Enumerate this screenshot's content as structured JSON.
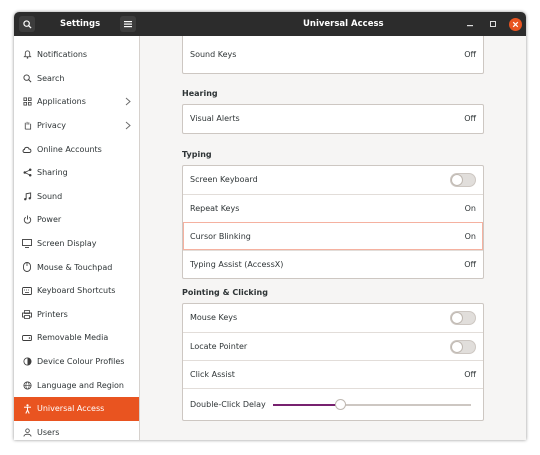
{
  "titlebar": {
    "left_title": "Settings",
    "title": "Universal Access",
    "search_icon": "search-icon",
    "menu_icon": "hamburger-menu-icon"
  },
  "sidebar": {
    "items": [
      {
        "label": "Notifications",
        "icon": "bell-icon"
      },
      {
        "label": "Search",
        "icon": "search-icon"
      },
      {
        "label": "Applications",
        "icon": "applications-grid-icon",
        "chevron": true
      },
      {
        "label": "Privacy",
        "icon": "hand-privacy-icon",
        "chevron": true
      },
      {
        "label": "Online Accounts",
        "icon": "cloud-icon"
      },
      {
        "label": "Sharing",
        "icon": "share-icon"
      },
      {
        "label": "Sound",
        "icon": "music-note-icon"
      },
      {
        "label": "Power",
        "icon": "power-icon"
      },
      {
        "label": "Screen Display",
        "icon": "monitor-icon"
      },
      {
        "label": "Mouse & Touchpad",
        "icon": "mouse-icon"
      },
      {
        "label": "Keyboard Shortcuts",
        "icon": "keyboard-icon"
      },
      {
        "label": "Printers",
        "icon": "printer-icon"
      },
      {
        "label": "Removable Media",
        "icon": "removable-media-icon"
      },
      {
        "label": "Device Colour Profiles",
        "icon": "color-profile-icon"
      },
      {
        "label": "Language and Region",
        "icon": "globe-icon"
      },
      {
        "label": "Universal Access",
        "icon": "accessibility-icon",
        "active": true
      },
      {
        "label": "Users",
        "icon": "users-icon"
      }
    ]
  },
  "content": {
    "top_frame": {
      "rows": [
        {
          "label": "Sound Keys",
          "value": "Off"
        }
      ]
    },
    "hearing": {
      "title": "Hearing",
      "rows": [
        {
          "label": "Visual Alerts",
          "value": "Off"
        }
      ]
    },
    "typing": {
      "title": "Typing",
      "rows": [
        {
          "label": "Screen Keyboard",
          "switch": false
        },
        {
          "label": "Repeat Keys",
          "value": "On"
        },
        {
          "label": "Cursor Blinking",
          "value": "On"
        },
        {
          "label": "Typing Assist (AccessX)",
          "value": "Off"
        }
      ]
    },
    "pointing": {
      "title": "Pointing & Clicking",
      "rows": [
        {
          "label": "Mouse Keys",
          "switch": false
        },
        {
          "label": "Locate Pointer",
          "switch": false
        },
        {
          "label": "Click Assist",
          "value": "Off"
        },
        {
          "label": "Double-Click Delay",
          "slider_fraction": 0.34
        }
      ]
    }
  },
  "colors": {
    "accent": "#e95420",
    "titlebar": "#2c2c2c",
    "slider_fill": "#77216f"
  }
}
